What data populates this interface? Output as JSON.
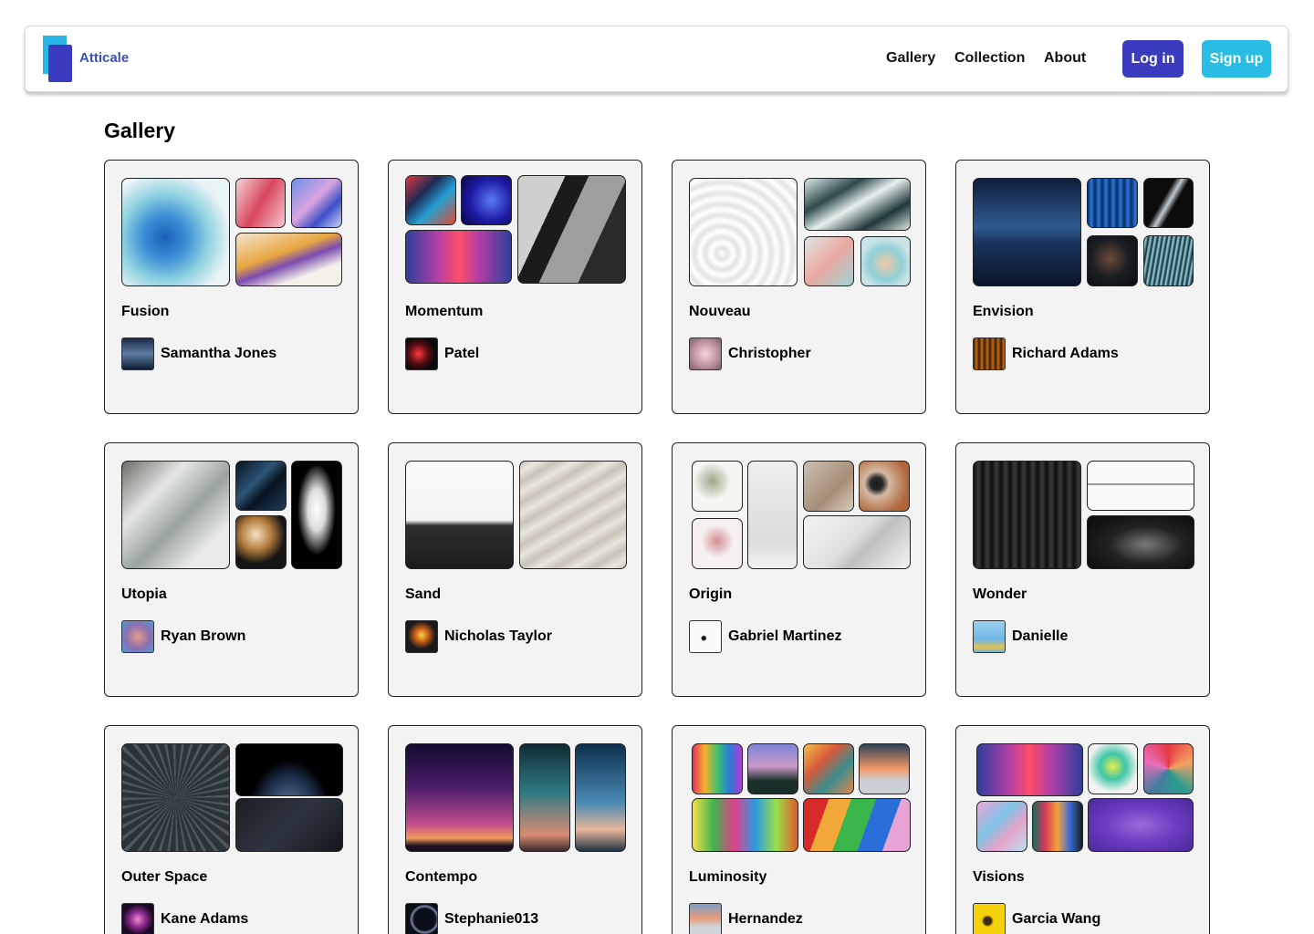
{
  "header": {
    "logo_text": "Atticale",
    "nav": [
      "Gallery",
      "Collection",
      "About"
    ],
    "login_label": "Log in",
    "signup_label": "Sign up",
    "colors": {
      "login": "#3a3bbf",
      "signup": "#29bde6"
    }
  },
  "page_title": "Gallery",
  "collections": [
    {
      "title": "Fusion",
      "author": "Samantha Jones"
    },
    {
      "title": "Momentum",
      "author": "Patel"
    },
    {
      "title": "Nouveau",
      "author": "Christopher"
    },
    {
      "title": "Envision",
      "author": "Richard Adams"
    },
    {
      "title": "Utopia",
      "author": "Ryan Brown"
    },
    {
      "title": "Sand",
      "author": "Nicholas Taylor"
    },
    {
      "title": "Origin",
      "author": "Gabriel Martinez"
    },
    {
      "title": "Wonder",
      "author": "Danielle"
    },
    {
      "title": "Outer Space",
      "author": "Kane Adams"
    },
    {
      "title": "Contempo",
      "author": "Stephanie013"
    },
    {
      "title": "Luminosity",
      "author": "Hernandez"
    },
    {
      "title": "Visions",
      "author": "Garcia Wang"
    }
  ]
}
